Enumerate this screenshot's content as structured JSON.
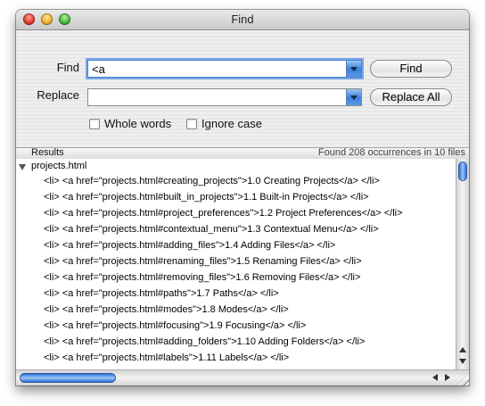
{
  "window": {
    "title": "Find"
  },
  "form": {
    "find_label": "Find",
    "find_value": "<a",
    "replace_label": "Replace",
    "replace_value": "",
    "find_button": "Find",
    "replace_all_button": "Replace All",
    "whole_words_label": "Whole words",
    "whole_words_checked": false,
    "ignore_case_label": "Ignore case",
    "ignore_case_checked": false
  },
  "results": {
    "header_label": "Results",
    "summary": "Found 208 occurrences in 10 files",
    "group": {
      "file": "projects.html",
      "expanded": true,
      "rows": [
        "<li> <a href=\"projects.html#creating_projects\">1.0 Creating Projects</a> </li>",
        "<li> <a href=\"projects.html#built_in_projects\">1.1 Built-in Projects</a> </li>",
        "<li> <a href=\"projects.html#project_preferences\">1.2 Project Preferences</a> </li>",
        "<li> <a href=\"projects.html#contextual_menu\">1.3 Contextual Menu</a> </li>",
        "<li> <a href=\"projects.html#adding_files\">1.4 Adding Files</a> </li>",
        "<li> <a href=\"projects.html#renaming_files\">1.5 Renaming Files</a> </li>",
        "<li> <a href=\"projects.html#removing_files\">1.6 Removing Files</a> </li>",
        "<li> <a href=\"projects.html#paths\">1.7 Paths</a> </li>",
        "<li> <a href=\"projects.html#modes\">1.8 Modes</a> </li>",
        "<li> <a href=\"projects.html#focusing\">1.9 Focusing</a> </li>",
        "<li> <a href=\"projects.html#adding_folders\">1.10 Adding Folders</a> </li>",
        "<li> <a href=\"projects.html#labels\">1.11 Labels</a> </li>"
      ]
    }
  },
  "icons": {
    "close": "close-button-icon",
    "minimize": "minimize-button-icon",
    "zoom": "zoom-button-icon",
    "disclosure": "disclosure-triangle-icon",
    "dropdown": "chevron-down-icon",
    "resize": "resize-grip-icon"
  },
  "colors": {
    "accent": "#3a7fd8",
    "focus_ring": "#7aa7e6"
  }
}
